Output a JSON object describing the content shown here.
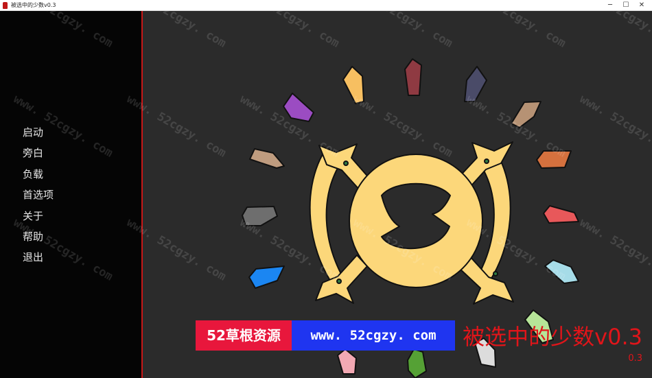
{
  "window": {
    "title": "被选中的少数v0.3",
    "icon": "app-icon",
    "controls": {
      "minimize": "─",
      "maximize": "☐",
      "close": "✕"
    }
  },
  "menu": {
    "items": [
      {
        "label": "启动"
      },
      {
        "label": "旁白"
      },
      {
        "label": "负载"
      },
      {
        "label": "首选项"
      },
      {
        "label": "关于"
      },
      {
        "label": "帮助"
      },
      {
        "label": "退出"
      }
    ]
  },
  "game": {
    "title": "被选中的少数v0.3",
    "version": "0.3"
  },
  "watermark": {
    "banner_left": "52草根资源",
    "banner_right": "www. 52cgzy. com",
    "diagonal_text": "www. 52cgzy. com"
  },
  "colors": {
    "sidebar_bg": "#050505",
    "sidebar_border": "#c81818",
    "stage_bg": "#2b2b2b",
    "emblem_fill": "#fcd77a",
    "title_red": "#e0151a",
    "menu_text": "#e6e6e6"
  }
}
